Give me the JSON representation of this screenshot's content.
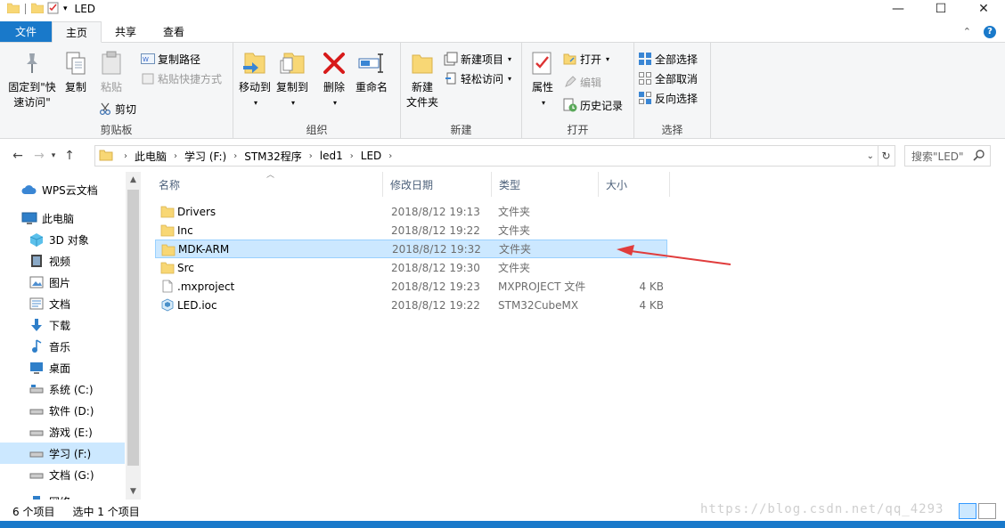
{
  "window": {
    "title": "LED"
  },
  "tabs": {
    "file": "文件",
    "home": "主页",
    "share": "共享",
    "view": "查看"
  },
  "ribbon": {
    "clipboard": {
      "label": "剪贴板",
      "pin_line1": "固定到\"快",
      "pin_line2": "速访问\"",
      "copy": "复制",
      "paste": "粘贴",
      "copy_path": "复制路径",
      "paste_shortcut": "粘贴快捷方式",
      "cut": "剪切"
    },
    "organize": {
      "label": "组织",
      "move_to": "移动到",
      "copy_to": "复制到",
      "delete": "删除",
      "rename": "重命名"
    },
    "new": {
      "label": "新建",
      "new_folder_line1": "新建",
      "new_folder_line2": "文件夹",
      "new_item": "新建项目",
      "easy_access": "轻松访问"
    },
    "open": {
      "label": "打开",
      "properties": "属性",
      "open": "打开",
      "edit": "编辑",
      "history": "历史记录"
    },
    "select": {
      "label": "选择",
      "select_all": "全部选择",
      "select_none": "全部取消",
      "invert": "反向选择"
    }
  },
  "address": {
    "crumbs": [
      "此电脑",
      "学习 (F:)",
      "STM32程序",
      "led1",
      "LED"
    ],
    "search_placeholder": "搜索\"LED\""
  },
  "nav": {
    "items": [
      {
        "label": "WPS云文档",
        "icon": "cloud-icon"
      },
      {
        "label": "此电脑",
        "icon": "computer-icon"
      },
      {
        "label": "3D 对象",
        "icon": "cube-icon"
      },
      {
        "label": "视频",
        "icon": "video-icon"
      },
      {
        "label": "图片",
        "icon": "picture-icon"
      },
      {
        "label": "文档",
        "icon": "document-icon"
      },
      {
        "label": "下载",
        "icon": "download-icon"
      },
      {
        "label": "音乐",
        "icon": "music-icon"
      },
      {
        "label": "桌面",
        "icon": "desktop-icon"
      },
      {
        "label": "系统 (C:)",
        "icon": "drive-icon"
      },
      {
        "label": "软件 (D:)",
        "icon": "drive-icon"
      },
      {
        "label": "游戏 (E:)",
        "icon": "drive-icon"
      },
      {
        "label": "学习 (F:)",
        "icon": "drive-icon"
      },
      {
        "label": "文档 (G:)",
        "icon": "drive-icon"
      },
      {
        "label": "网络",
        "icon": "network-icon"
      }
    ]
  },
  "columns": {
    "name": "名称",
    "date": "修改日期",
    "type": "类型",
    "size": "大小"
  },
  "files": [
    {
      "name": "Drivers",
      "date": "2018/8/12 19:13",
      "type": "文件夹",
      "size": "",
      "icon": "folder-icon"
    },
    {
      "name": "Inc",
      "date": "2018/8/12 19:22",
      "type": "文件夹",
      "size": "",
      "icon": "folder-icon"
    },
    {
      "name": "MDK-ARM",
      "date": "2018/8/12 19:32",
      "type": "文件夹",
      "size": "",
      "icon": "folder-icon"
    },
    {
      "name": "Src",
      "date": "2018/8/12 19:30",
      "type": "文件夹",
      "size": "",
      "icon": "folder-icon"
    },
    {
      "name": ".mxproject",
      "date": "2018/8/12 19:23",
      "type": "MXPROJECT 文件",
      "size": "4 KB",
      "icon": "file-icon"
    },
    {
      "name": "LED.ioc",
      "date": "2018/8/12 19:22",
      "type": "STM32CubeMX",
      "size": "4 KB",
      "icon": "cubemx-icon"
    }
  ],
  "status": {
    "count": "6 个项目",
    "selected": "选中 1 个项目"
  },
  "watermark": "https://blog.csdn.net/qq_4293",
  "colors": {
    "accent": "#1979ca",
    "selection": "#cce8ff",
    "arrow": "#e03c3c",
    "folder": "#f8d775"
  }
}
